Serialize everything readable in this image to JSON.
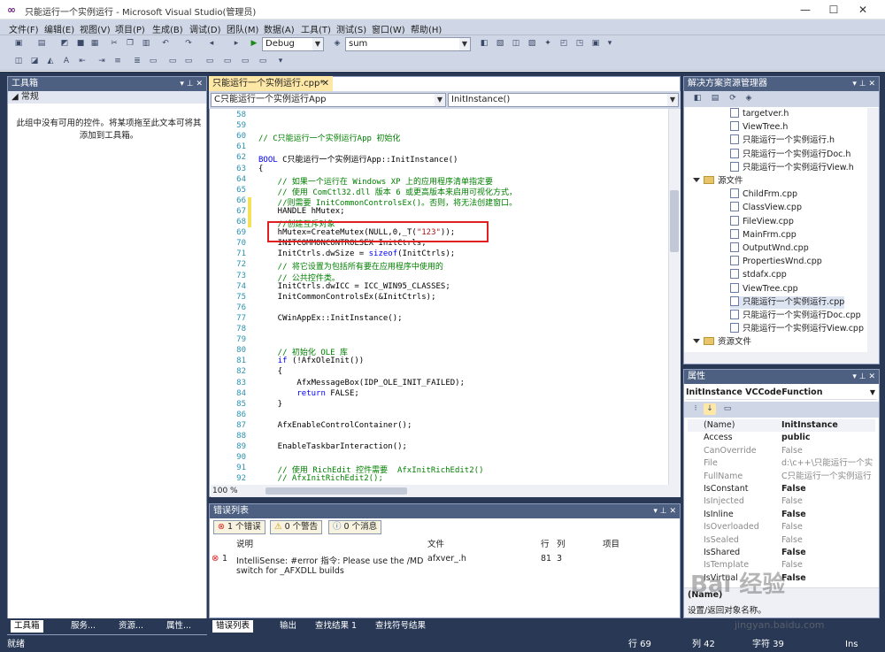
{
  "window": {
    "title": "只能运行一个实例运行 - Microsoft Visual Studio(管理员)",
    "min": "—",
    "max": "☐",
    "close": "✕"
  },
  "menu": [
    "文件(F)",
    "编辑(E)",
    "视图(V)",
    "项目(P)",
    "生成(B)",
    "调试(D)",
    "团队(M)",
    "数据(A)",
    "工具(T)",
    "测试(S)",
    "窗口(W)",
    "帮助(H)"
  ],
  "toolbar": {
    "config": "Debug",
    "search": "sum",
    "start": "▶"
  },
  "toolbox": {
    "header": "工具箱",
    "section": "◢ 常规",
    "message": "此组中没有可用的控件。将某项拖至此文本可将其添加到工具箱。"
  },
  "left_tabs": [
    "工具箱",
    "服务...",
    "资源...",
    "属性..."
  ],
  "editor": {
    "tab": "只能运行一个实例运行.cpp*",
    "class_combo": "C只能运行一个实例运行App",
    "method_combo": "InitInstance()",
    "zoom": "100 %",
    "lines": [
      {
        "n": "58",
        "t": "",
        "c": ""
      },
      {
        "n": "59",
        "t": "",
        "c": ""
      },
      {
        "n": "60",
        "t": "// C只能运行一个实例运行App 初始化",
        "c": "cm"
      },
      {
        "n": "61",
        "t": "",
        "c": ""
      },
      {
        "n": "62",
        "t": "BOOL C只能运行一个实例运行App::InitInstance()",
        "c": ""
      },
      {
        "n": "63",
        "t": "{",
        "c": ""
      },
      {
        "n": "64",
        "t": "    // 如果一个运行在 Windows XP 上的应用程序清单指定要",
        "c": "cm"
      },
      {
        "n": "65",
        "t": "    // 使用 ComCtl32.dll 版本 6 或更高版本来启用可视化方式，",
        "c": "cm"
      },
      {
        "n": "66",
        "t": "    //则需要 InitCommonControlsEx()。否则，将无法创建窗口。",
        "c": "cm"
      },
      {
        "n": "67",
        "t": "    HANDLE hMutex;",
        "c": ""
      },
      {
        "n": "68",
        "t": "    //创建互斥对象",
        "c": "cm"
      },
      {
        "n": "69",
        "t": "    hMutex=CreateMutex(NULL,0,_T(\"123\"));",
        "c": ""
      },
      {
        "n": "70",
        "t": "    INITCOMMONCONTROLSEX InitCtrls;",
        "c": ""
      },
      {
        "n": "71",
        "t": "    InitCtrls.dwSize = sizeof(InitCtrls);",
        "c": ""
      },
      {
        "n": "72",
        "t": "    // 将它设置为包括所有要在应用程序中使用的",
        "c": "cm"
      },
      {
        "n": "73",
        "t": "    // 公共控件类。",
        "c": "cm"
      },
      {
        "n": "74",
        "t": "    InitCtrls.dwICC = ICC_WIN95_CLASSES;",
        "c": ""
      },
      {
        "n": "75",
        "t": "    InitCommonControlsEx(&InitCtrls);",
        "c": ""
      },
      {
        "n": "76",
        "t": "",
        "c": ""
      },
      {
        "n": "77",
        "t": "    CWinAppEx::InitInstance();",
        "c": ""
      },
      {
        "n": "78",
        "t": "",
        "c": ""
      },
      {
        "n": "79",
        "t": "",
        "c": ""
      },
      {
        "n": "80",
        "t": "    // 初始化 OLE 库",
        "c": "cm"
      },
      {
        "n": "81",
        "t": "    if (!AfxOleInit())",
        "c": ""
      },
      {
        "n": "82",
        "t": "    {",
        "c": ""
      },
      {
        "n": "83",
        "t": "        AfxMessageBox(IDP_OLE_INIT_FAILED);",
        "c": ""
      },
      {
        "n": "84",
        "t": "        return FALSE;",
        "c": ""
      },
      {
        "n": "85",
        "t": "    }",
        "c": ""
      },
      {
        "n": "86",
        "t": "",
        "c": ""
      },
      {
        "n": "87",
        "t": "    AfxEnableControlContainer();",
        "c": ""
      },
      {
        "n": "88",
        "t": "",
        "c": ""
      },
      {
        "n": "89",
        "t": "    EnableTaskbarInteraction();",
        "c": ""
      },
      {
        "n": "90",
        "t": "",
        "c": ""
      },
      {
        "n": "91",
        "t": "    // 使用 RichEdit 控件需要  AfxInitRichEdit2()",
        "c": "cm"
      },
      {
        "n": "92",
        "t": "    // AfxInitRichEdit2();",
        "c": "cm"
      }
    ]
  },
  "errors": {
    "header": "错误列表",
    "filter_errors": "1 个错误",
    "filter_warnings": "0 个警告",
    "filter_messages": "0 个消息",
    "columns": [
      "说明",
      "文件",
      "行",
      "列",
      "项目"
    ],
    "row": {
      "index": "1",
      "desc1": "IntelliSense: #error 指令: Please use the /MD",
      "desc2": "switch for _AFXDLL builds",
      "file": "afxver_.h",
      "line": "81",
      "col": "3",
      "project": ""
    }
  },
  "bottom_tabs": [
    "错误列表",
    "输出",
    "查找结果 1",
    "查找符号结果"
  ],
  "solution": {
    "header": "解决方案资源管理器",
    "items": [
      {
        "label": "targetver.h",
        "type": "file",
        "indent": 1
      },
      {
        "label": "ViewTree.h",
        "type": "file",
        "indent": 1
      },
      {
        "label": "只能运行一个实例运行.h",
        "type": "file",
        "indent": 1
      },
      {
        "label": "只能运行一个实例运行Doc.h",
        "type": "file",
        "indent": 1
      },
      {
        "label": "只能运行一个实例运行View.h",
        "type": "file",
        "indent": 1
      },
      {
        "label": "源文件",
        "type": "folder",
        "indent": 0
      },
      {
        "label": "ChildFrm.cpp",
        "type": "file",
        "indent": 1
      },
      {
        "label": "ClassView.cpp",
        "type": "file",
        "indent": 1
      },
      {
        "label": "FileView.cpp",
        "type": "file",
        "indent": 1
      },
      {
        "label": "MainFrm.cpp",
        "type": "file",
        "indent": 1
      },
      {
        "label": "OutputWnd.cpp",
        "type": "file",
        "indent": 1
      },
      {
        "label": "PropertiesWnd.cpp",
        "type": "file",
        "indent": 1
      },
      {
        "label": "stdafx.cpp",
        "type": "file",
        "indent": 1
      },
      {
        "label": "ViewTree.cpp",
        "type": "file",
        "indent": 1
      },
      {
        "label": "只能运行一个实例运行.cpp",
        "type": "file",
        "indent": 1
      },
      {
        "label": "只能运行一个实例运行Doc.cpp",
        "type": "file",
        "indent": 1
      },
      {
        "label": "只能运行一个实例运行View.cpp",
        "type": "file",
        "indent": 1
      },
      {
        "label": "资源文件",
        "type": "folder",
        "indent": 0
      }
    ]
  },
  "properties": {
    "header": "属性",
    "object": "InitInstance VCCodeFunction",
    "rows": [
      {
        "name": "(Name)",
        "value": "InitInstance",
        "dim": false
      },
      {
        "name": "Access",
        "value": "public",
        "dim": false
      },
      {
        "name": "CanOverride",
        "value": "False",
        "dim": true
      },
      {
        "name": "File",
        "value": "d:\\c++\\只能运行一个实",
        "dim": true
      },
      {
        "name": "FullName",
        "value": "C只能运行一个实例运行",
        "dim": true
      },
      {
        "name": "IsConstant",
        "value": "False",
        "dim": false
      },
      {
        "name": "IsInjected",
        "value": "False",
        "dim": true
      },
      {
        "name": "IsInline",
        "value": "False",
        "dim": false
      },
      {
        "name": "IsOverloaded",
        "value": "False",
        "dim": true
      },
      {
        "name": "IsSealed",
        "value": "False",
        "dim": true
      },
      {
        "name": "IsShared",
        "value": "False",
        "dim": false
      },
      {
        "name": "IsTemplate",
        "value": "False",
        "dim": true
      },
      {
        "name": "IsVirtual",
        "value": "False",
        "dim": false
      }
    ],
    "desc_title": "(Name)",
    "desc_text": "设置/返回对象名称。"
  },
  "status": {
    "ready": "就绪",
    "line": "行 69",
    "col": "列 42",
    "char": "字符 39",
    "mode": "Ins"
  },
  "watermark": {
    "main": "Bai 经验",
    "sub": "jingyan.baidu.com"
  }
}
